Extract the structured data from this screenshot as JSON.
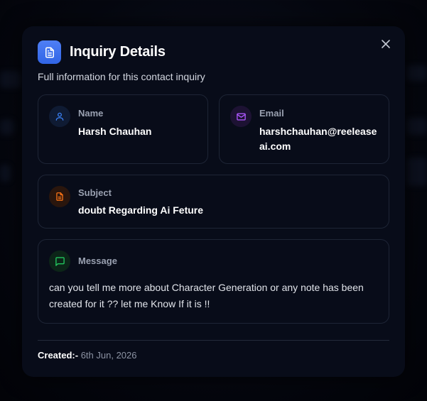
{
  "modal": {
    "title": "Inquiry Details",
    "subtitle": "Full information for this contact inquiry",
    "close_icon": "close-icon",
    "header_icon": "document-icon"
  },
  "fields": {
    "name": {
      "label": "Name",
      "value": "Harsh Chauhan",
      "icon": "user-icon",
      "color": "#3b82f6"
    },
    "email": {
      "label": "Email",
      "value_line1": "harshchauhan@reelease",
      "value_line2": "ai.com",
      "icon": "mail-icon",
      "color": "#a855f7"
    },
    "subject": {
      "label": "Subject",
      "value": "doubt Regarding Ai Feture",
      "icon": "document-icon",
      "color": "#f97316"
    },
    "message": {
      "label": "Message",
      "line1": "can you tell me more about Character Generation or any note has been",
      "line2": "created for it ?? let me Know If it is !!",
      "icon": "chat-icon",
      "color": "#22c55e"
    }
  },
  "footer": {
    "created_label": "Created:-",
    "created_value": "6th Jun, 2026"
  }
}
